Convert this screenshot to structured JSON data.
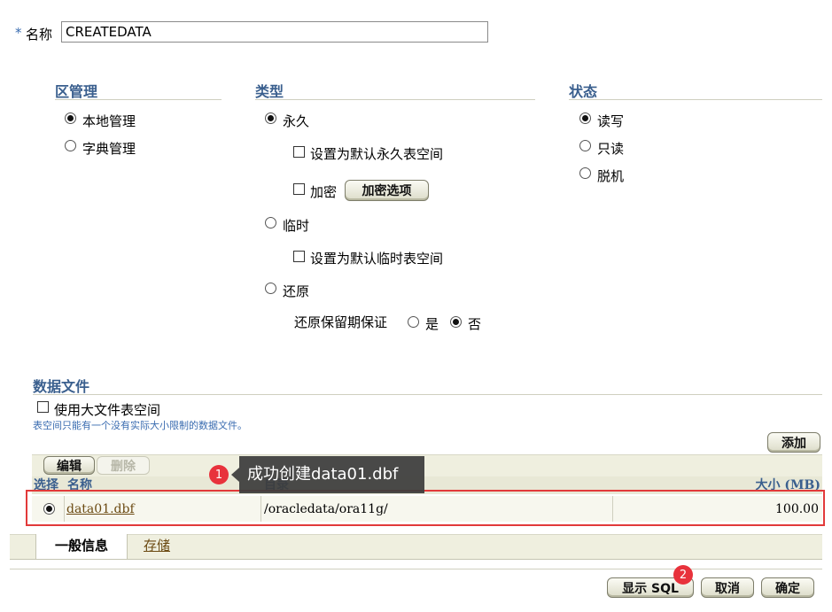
{
  "name_field": {
    "required_mark": "*",
    "label": "名称",
    "value": "CREATEDATA"
  },
  "extent_mgmt": {
    "title": "区管理",
    "options": [
      "本地管理",
      "字典管理"
    ],
    "selected": "本地管理"
  },
  "type": {
    "title": "类型",
    "permanent": "永久",
    "default_permanent": "设置为默认永久表空间",
    "encrypt": "加密",
    "encrypt_options_button": "加密选项",
    "temporary": "临时",
    "default_temporary": "设置为默认临时表空间",
    "undo": "还原",
    "undo_retention": "还原保留期保证",
    "yes": "是",
    "no": "否",
    "selected": "永久",
    "undo_retention_selected": "否"
  },
  "status": {
    "title": "状态",
    "options": [
      "读写",
      "只读",
      "脱机"
    ],
    "selected": "读写"
  },
  "datafiles": {
    "title": "数据文件",
    "bigfile_label": "使用大文件表空间",
    "hint": "表空间只能有一个没有实际大小限制的数据文件。",
    "add_button": "添加",
    "edit_button": "编辑",
    "delete_button": "删除",
    "columns": {
      "select": "选择",
      "name": "名称",
      "directory": "目录",
      "size": "大小 (MB)"
    },
    "rows": [
      {
        "name": "data01.dbf",
        "directory": "/oracledata/ora11g/",
        "size": "100.00"
      }
    ]
  },
  "annotations": {
    "badge1": "1",
    "tooltip": "成功创建data01.dbf",
    "badge2": "2",
    "highlight_color": "#e23a3a",
    "badge_color": "#e8323c"
  },
  "tabs": {
    "general": "一般信息",
    "storage": "存储"
  },
  "footer": {
    "show_sql": "显示 SQL",
    "cancel": "取消",
    "ok": "确定"
  }
}
